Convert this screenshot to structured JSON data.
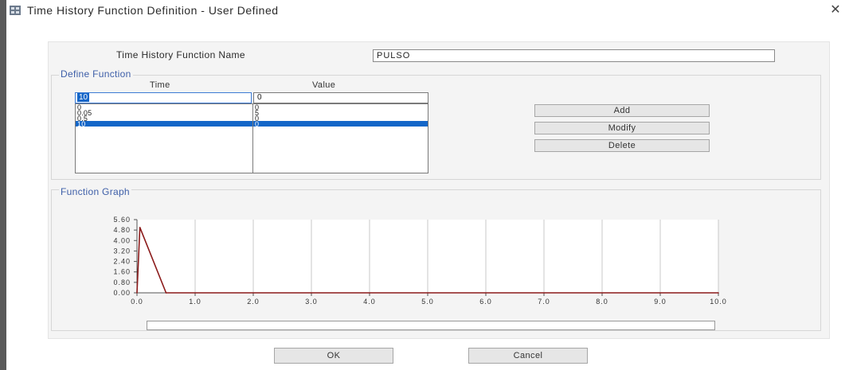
{
  "window": {
    "title": "Time History Function Definition  - User Defined",
    "close_glyph": "✕",
    "icon": "app-icon"
  },
  "function_name": {
    "label": "Time History Function Name",
    "value": "PULSO"
  },
  "define_function": {
    "title": "Define Function",
    "time_header": "Time",
    "value_header": "Value",
    "time_edit": "10",
    "value_edit": "0",
    "rows": [
      {
        "time": "0",
        "value": "0"
      },
      {
        "time": "0.05",
        "value": "5"
      },
      {
        "time": "0.5",
        "value": "0"
      },
      {
        "time": "10",
        "value": "0"
      }
    ],
    "selected_index": 3,
    "buttons": {
      "add": "Add",
      "modify": "Modify",
      "delete": "Delete"
    }
  },
  "function_graph": {
    "title": "Function Graph"
  },
  "chart_data": {
    "type": "line",
    "x": [
      0,
      0.05,
      0.5,
      10
    ],
    "y": [
      0,
      5,
      0,
      0
    ],
    "xlim": [
      0,
      10
    ],
    "ylim": [
      0,
      5.6
    ],
    "x_ticks": [
      "0.0",
      "1.0",
      "2.0",
      "3.0",
      "4.0",
      "5.0",
      "6.0",
      "7.0",
      "8.0",
      "9.0",
      "10.0"
    ],
    "y_ticks": [
      "0.00",
      "0.80",
      "1.60",
      "2.40",
      "3.20",
      "4.00",
      "4.80",
      "5.60"
    ],
    "grid": true,
    "line_color": "#8b1a1a",
    "grid_color": "#c8c8c8"
  },
  "footer": {
    "ok": "OK",
    "cancel": "Cancel"
  }
}
